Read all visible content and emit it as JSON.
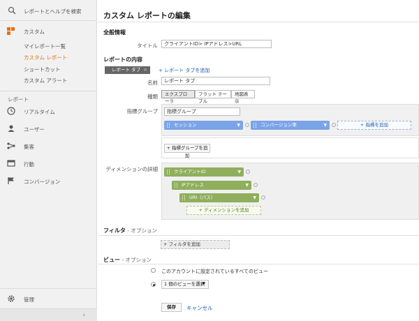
{
  "sidebar": {
    "search_label": "レポートとヘルプを検索",
    "custom_header": "カスタム",
    "custom_items": [
      {
        "label": "マイレポート一覧",
        "active": false
      },
      {
        "label": "カスタム レポート",
        "active": true
      },
      {
        "label": "ショートカット",
        "active": false
      },
      {
        "label": "カスタム アラート",
        "active": false
      }
    ],
    "reports_label": "レポート",
    "report_items": [
      "リアルタイム",
      "ユーザー",
      "集客",
      "行動",
      "コンバージョン"
    ],
    "admin_label": "管理"
  },
  "main": {
    "title": "カスタム レポートの編集",
    "general": {
      "heading": "全般情報",
      "title_label": "タイトル",
      "title_value": "クライアントID> IPアドレス>URL"
    },
    "content": {
      "heading": "レポートの内容",
      "tab_chip": "レポート タブ",
      "add_tab_link": "+ レポート タブを追加",
      "name_label": "名前",
      "name_value": "レポート タブ",
      "type_label": "種類",
      "types": [
        "エクスプローラ",
        "フラット テーブル",
        "地図表示"
      ],
      "metric_group_label": "指標グループ",
      "metric_group_value": "指標グループ",
      "metrics": [
        "セッション",
        "コンバージョン率"
      ],
      "add_metric": "+ 指標を追加",
      "add_metric_group": "+ 指標グループを追加",
      "dimension_label": "ディメンションの詳細",
      "dimensions": [
        "クライアントID",
        "IPアドレス",
        "URI（パス）"
      ],
      "add_dimension": "+ ディメンションを追加"
    },
    "filter": {
      "heading": "フィルタ",
      "optional": " - オプション",
      "add_filter": "+ フィルタを追加"
    },
    "view": {
      "heading": "ビュー",
      "optional": " - オプション",
      "option_all": "このアカウントに設定されているすべてのビュー",
      "option_select": "1 個のビューを選択"
    },
    "actions": {
      "save": "保存",
      "cancel": "キャンセル"
    }
  },
  "colors": {
    "accent_orange": "#e8710a",
    "metric_blue": "#7ba4e8",
    "dimension_green": "#8faf5d",
    "link_blue": "#1a5ba8"
  }
}
